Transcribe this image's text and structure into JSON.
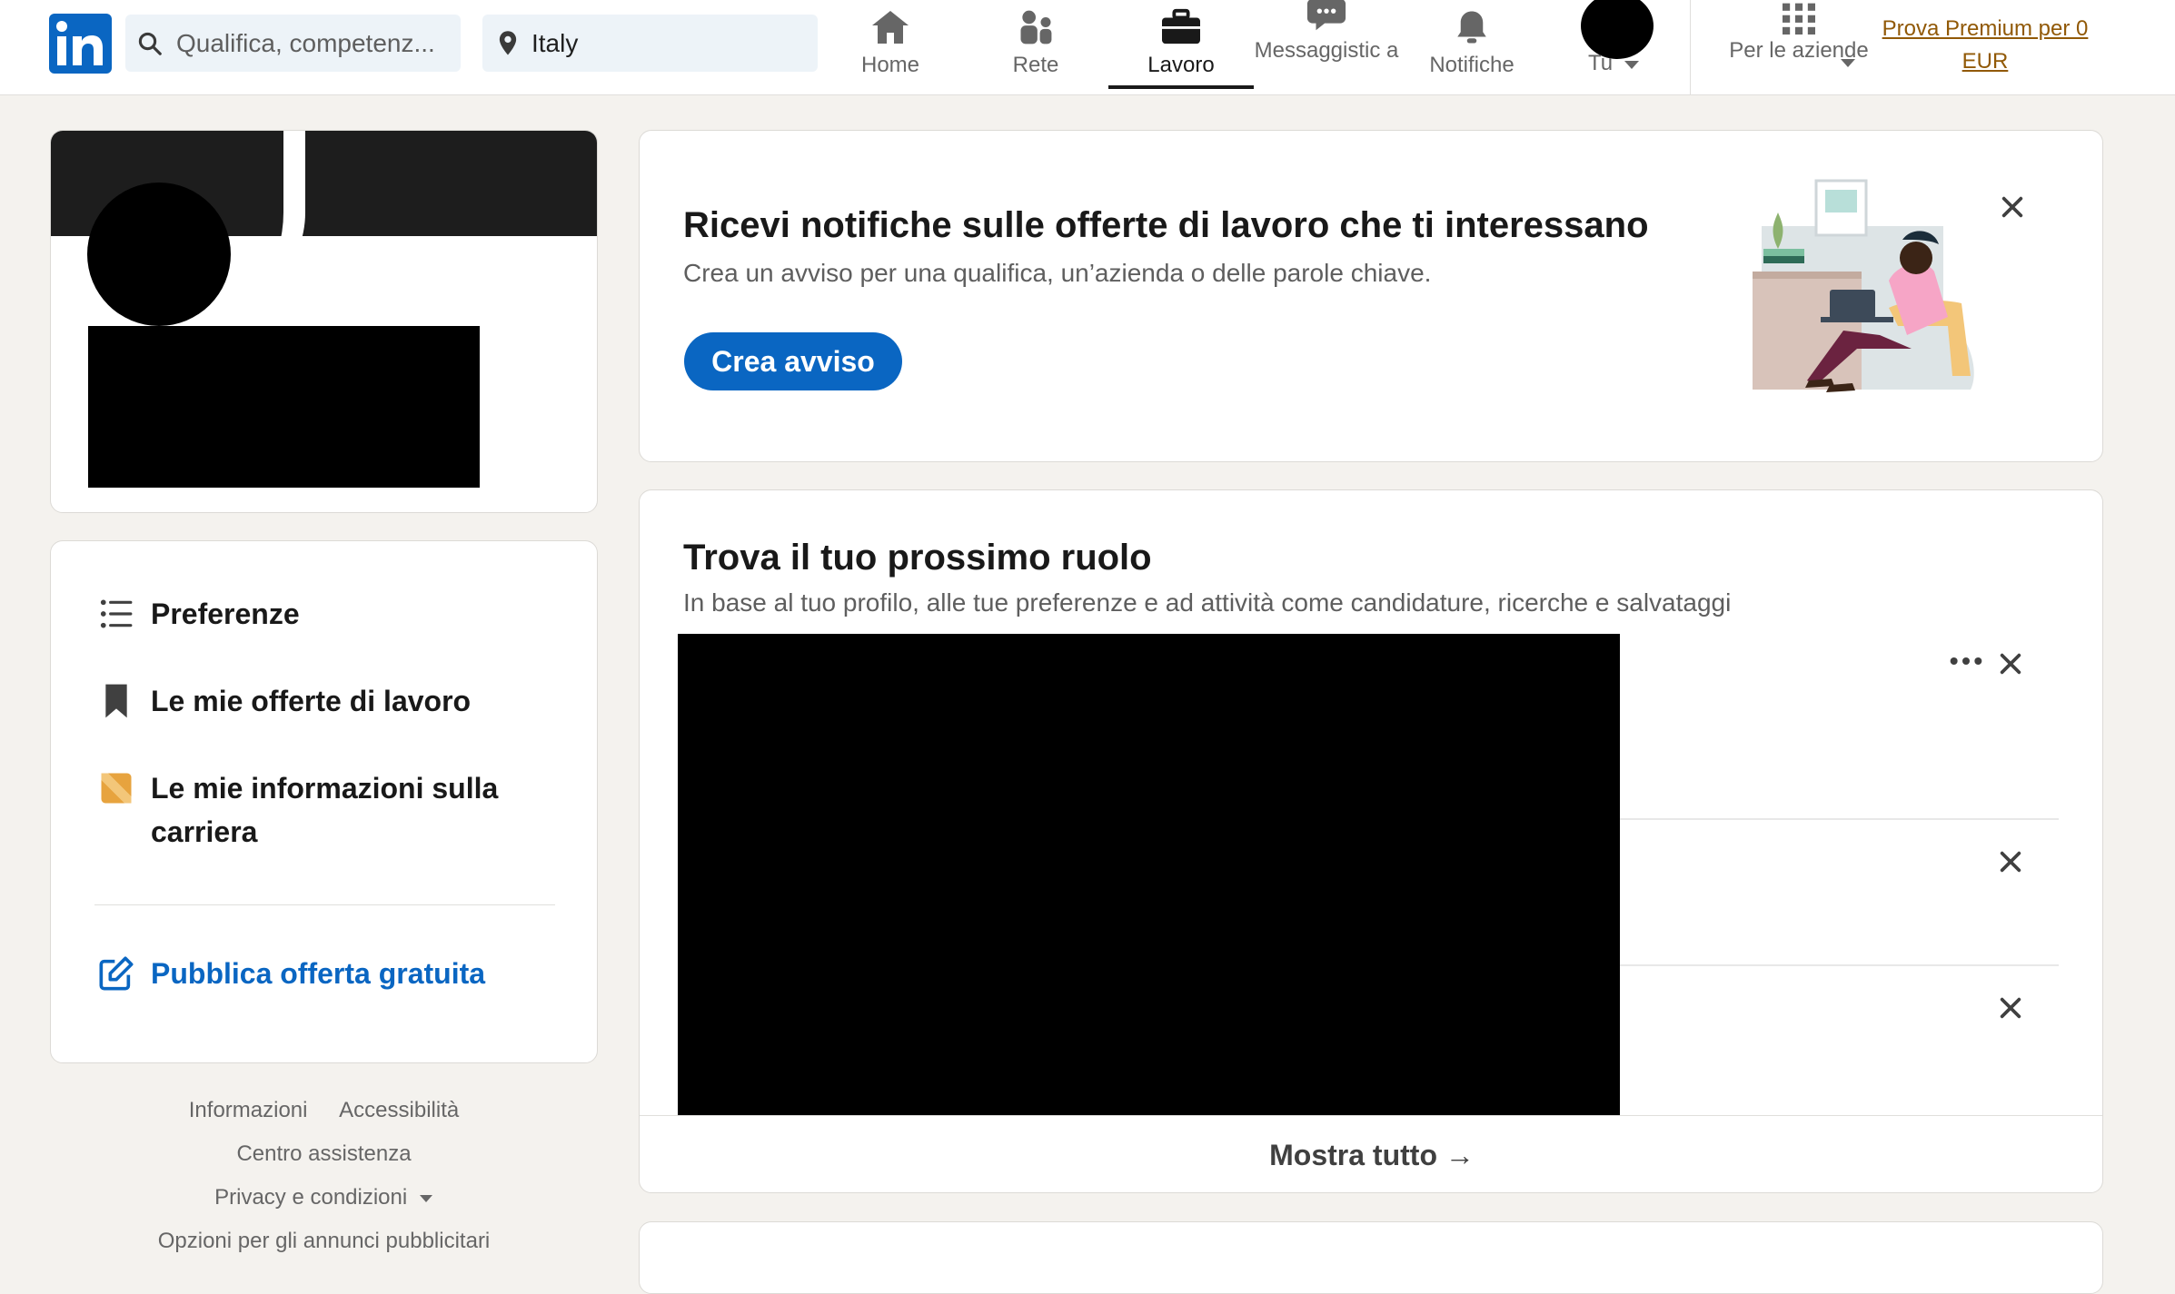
{
  "nav": {
    "search_placeholder": "Qualifica, competenz...",
    "location_value": "Italy",
    "items": [
      {
        "label": "Home",
        "icon": "home-icon"
      },
      {
        "label": "Rete",
        "icon": "network-icon"
      },
      {
        "label": "Lavoro",
        "icon": "briefcase-icon",
        "active": true
      },
      {
        "label": "Messaggistic a",
        "icon": "messaging-icon"
      },
      {
        "label": "Notifiche",
        "icon": "bell-icon"
      }
    ],
    "me_label": "Tu",
    "business_label": "Per le aziende",
    "premium_label": "Prova Premium per 0 EUR",
    "colors": {
      "brand": "#0a66c2",
      "premium": "#915907"
    }
  },
  "sidebar": {
    "menu": [
      {
        "label": "Preferenze",
        "icon": "list-icon"
      },
      {
        "label": "Le mie offerte di lavoro",
        "icon": "bookmark-icon"
      },
      {
        "label": "Le mie informazioni sulla carriera",
        "icon": "career-insights-icon"
      }
    ],
    "post_job_label": "Pubblica offerta gratuita"
  },
  "footer": {
    "links": [
      "Informazioni",
      "Accessibilità",
      "Centro assistenza",
      "Privacy e condizioni",
      "Opzioni per gli annunci pubblicitari"
    ]
  },
  "alert": {
    "title": "Ricevi notifiche sulle offerte di lavoro che ti interessano",
    "subtitle": "Crea un avviso per una qualifica, un’azienda o delle parole chiave.",
    "button_label": "Crea avviso"
  },
  "jobs": {
    "title": "Trova il tuo prossimo ruolo",
    "subtitle": "In base al tuo profilo, alle tue preferenze e ad attività come candidature, ricerche e salvataggi",
    "show_all_label": "Mostra tutto →"
  }
}
